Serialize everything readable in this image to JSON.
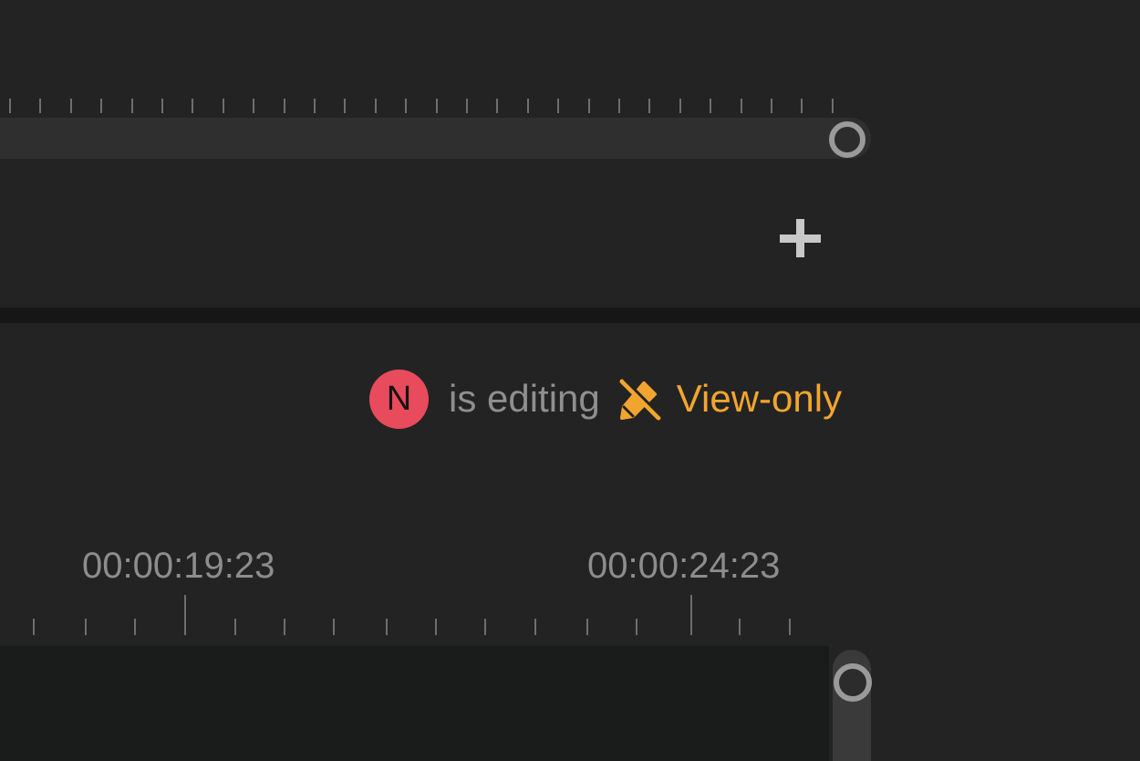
{
  "upper_panel": {
    "add_label": "+"
  },
  "collaboration": {
    "avatar_initial": "N",
    "status_text": "is editing",
    "mode_label": "View-only",
    "mode_icon": "pencil-off-icon",
    "avatar_color": "#e84b5c",
    "mode_color": "#f2a52e"
  },
  "timeline": {
    "timecodes": [
      "00:00:19:23",
      "00:00:24:23"
    ]
  }
}
